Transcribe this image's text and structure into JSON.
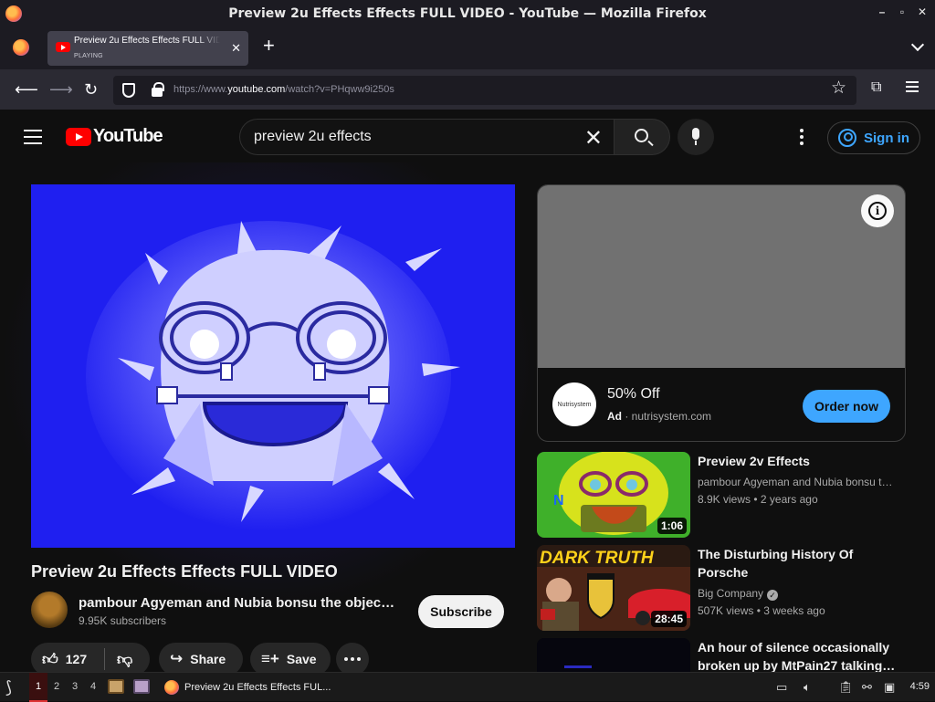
{
  "window": {
    "title": "Preview 2u Effects Effects FULL VIDEO - YouTube — Mozilla Firefox",
    "controls": [
      "–",
      "▫",
      "✕"
    ]
  },
  "tab": {
    "title": "Preview 2u Effects Effects FULL VIDEO - YouTube",
    "status": "PLAYING"
  },
  "navbar": {
    "url_prefix": "https://www.",
    "url_domain": "youtube.com",
    "url_path": "/watch?v=PHqww9i250s"
  },
  "youtube": {
    "logo_text": "YouTube",
    "search_query": "preview 2u effects",
    "sign_in_label": "Sign in",
    "video": {
      "title": "Preview 2u Effects Effects FULL VIDEO",
      "channel": "pambour Agyeman and Nubia bonsu the object show fan",
      "subscribers": "9.95K subscribers",
      "subscribe_label": "Subscribe",
      "likes": "127",
      "share_label": "Share",
      "save_label": "Save"
    },
    "ad": {
      "headline": "50% Off",
      "badge": "Ad",
      "domain": "nutrisystem.com",
      "brand": "Nutrisystem",
      "cta": "Order now"
    },
    "recommendations": [
      {
        "title": "Preview 2v Effects",
        "channel": "pambour Agyeman and Nubia bonsu the object show fan",
        "views": "8.9K views",
        "age": "2 years ago",
        "duration": "1:06",
        "thumb_text": "N"
      },
      {
        "title": "The Disturbing History Of Porsche",
        "channel": "Big Company",
        "verified": true,
        "views": "507K views",
        "age": "3 weeks ago",
        "duration": "28:45",
        "thumb_text": "DARK TRUTH"
      },
      {
        "title": "An hour of silence occasionally broken up by MtPain27 talking…",
        "channel": "",
        "views": "",
        "age": "",
        "duration": ""
      }
    ]
  },
  "taskbar": {
    "workspaces": [
      "1",
      "2",
      "3",
      "4"
    ],
    "active_workspace": "1",
    "task_title": "Preview 2u Effects Effects FUL...",
    "clock": "4:59"
  }
}
